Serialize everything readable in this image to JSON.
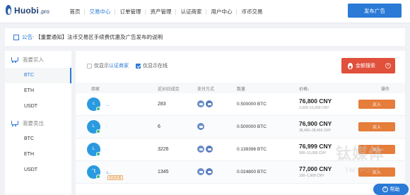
{
  "header": {
    "logo_text": "Huobi",
    "logo_sub": ".pro",
    "nav": [
      "首页",
      "交易中心",
      "订单管理",
      "资产管理",
      "认证商家",
      "用户中心",
      "币币交易"
    ],
    "publish_label": "发布广告"
  },
  "notice": {
    "prefix": "公告:",
    "text": "【重要通知】法币交易区手续费优惠及广告发布的说明"
  },
  "sidebar": {
    "buy_label": "我要买入",
    "buy_items": [
      "BTC",
      "ETH",
      "USDT"
    ],
    "sell_label": "我要卖出",
    "sell_items": [
      "BTC",
      "ETH",
      "USDT"
    ]
  },
  "filters": {
    "only_show": "仅显示",
    "verified_link": "认证商家",
    "only_online": "仅显示在线",
    "amount_search": "金额搜索"
  },
  "table": {
    "headers": [
      "商家",
      "近30日成交",
      "支付方式",
      "数量",
      "价格↓",
      "操作"
    ],
    "rows": [
      {
        "avatar": "c",
        "trades": "283",
        "amount": "0.500000 BTC",
        "price": "76,800 CNY",
        "limit": "2,000–15,000 CNY",
        "action": "买入"
      },
      {
        "avatar": "L",
        "trades": "6",
        "amount": "0.500000 BTC",
        "price": "76,900 CNY",
        "limit": "38,450–38,450 CNY",
        "action": "买入"
      },
      {
        "avatar": "L",
        "trades": "3226",
        "amount": "0.139396 BTC",
        "price": "76,999 CNY",
        "limit": "500–10,000 CNY",
        "action": "买入"
      },
      {
        "avatar": "飞",
        "badge": "优质商家",
        "trades": "1345",
        "amount": "0.024800 BTC",
        "price": "77,000 CNY",
        "limit": "100–1,909 CNY",
        "action": "买入"
      }
    ]
  },
  "help": "帮助",
  "watermark": "钛媒体",
  "watermark_sub": "TMTPOST"
}
